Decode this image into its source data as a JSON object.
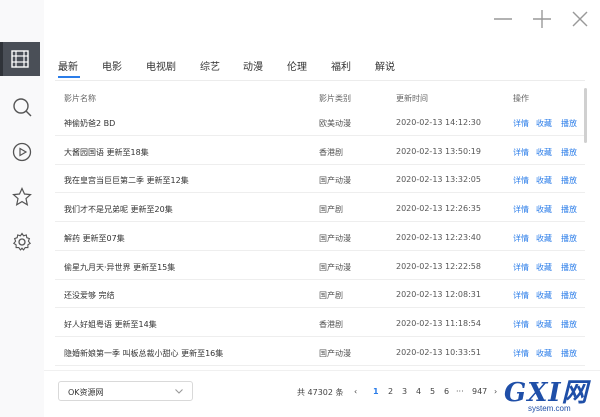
{
  "window": {
    "minimize": "minimize",
    "maximize": "maximize",
    "close": "close"
  },
  "sidebar": {
    "items": [
      {
        "icon": "video-library-icon",
        "active": true
      },
      {
        "icon": "search-icon",
        "active": false
      },
      {
        "icon": "play-circle-icon",
        "active": false
      },
      {
        "icon": "star-icon",
        "active": false
      },
      {
        "icon": "gear-icon",
        "active": false
      }
    ]
  },
  "tabs": [
    "最新",
    "电影",
    "电视剧",
    "综艺",
    "动漫",
    "伦理",
    "福利",
    "解说"
  ],
  "table": {
    "headers": {
      "name": "影片名称",
      "type": "影片类别",
      "time": "更新时间",
      "action": "操作"
    },
    "action_labels": {
      "detail": "详情",
      "favorite": "收藏",
      "play": "播放"
    },
    "rows": [
      {
        "name": "神偷奶爸2 BD",
        "type": "欧美动漫",
        "time": "2020-02-13 14:12:30"
      },
      {
        "name": "大酱园国语 更新至18集",
        "type": "香港剧",
        "time": "2020-02-13 13:50:19"
      },
      {
        "name": "我在皇宫当巨巨第二季 更新至12集",
        "type": "国产动漫",
        "time": "2020-02-13 13:32:05"
      },
      {
        "name": "我们才不是兄弟呢 更新至20集",
        "type": "国产剧",
        "time": "2020-02-13 12:26:35"
      },
      {
        "name": "解药 更新至07集",
        "type": "国产动漫",
        "time": "2020-02-13 12:23:40"
      },
      {
        "name": "偷星九月天·异世界 更新至15集",
        "type": "国产动漫",
        "time": "2020-02-13 12:22:58"
      },
      {
        "name": "还没爱够 完结",
        "type": "国产剧",
        "time": "2020-02-13 12:08:31"
      },
      {
        "name": "好人好姐粤语 更新至14集",
        "type": "香港剧",
        "time": "2020-02-13 11:18:54"
      },
      {
        "name": "隐婚新娘第一季 叫板总裁小甜心 更新至16集",
        "type": "国产动漫",
        "time": "2020-02-13 10:33:51"
      }
    ]
  },
  "footer": {
    "source": "OK资源网",
    "total": "共 47302 条",
    "prev": "‹",
    "pages": [
      "1",
      "2",
      "3",
      "4",
      "5",
      "6"
    ],
    "ellipsis": "···",
    "last": "947",
    "next": "›"
  },
  "watermark": {
    "brand": "GXI网",
    "domain": "system.com"
  },
  "colors": {
    "accent": "#2b7de9",
    "sidebar_active": "#4a4f57"
  }
}
